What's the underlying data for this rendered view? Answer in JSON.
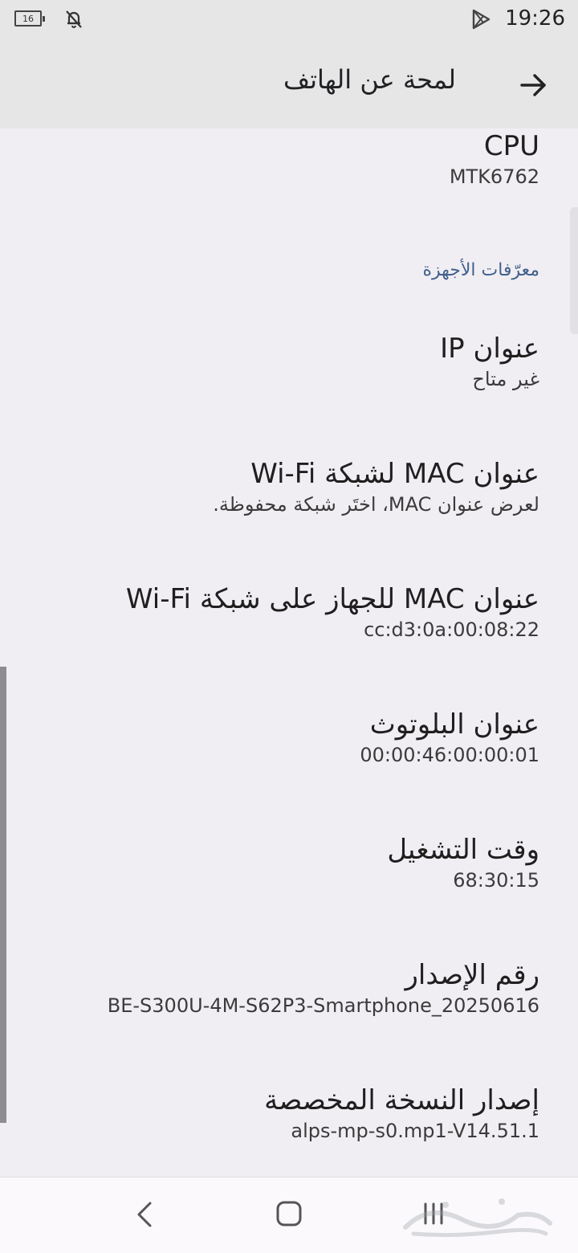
{
  "status_bar": {
    "battery_level": "16",
    "time": "19:26",
    "icons": [
      "battery-icon",
      "bell-off-icon",
      "play-store-icon"
    ]
  },
  "header": {
    "title": "لمحة عن الهاتف",
    "back_icon": "back-arrow-icon"
  },
  "content": {
    "cpu": {
      "title": "CPU",
      "summary": "MTK6762"
    },
    "category_label": "معرّفات الأجهزة",
    "items": [
      {
        "title": "عنوان IP",
        "summary": "غير متاح"
      },
      {
        "title": "عنوان MAC لشبكة Wi-Fi",
        "summary": "لعرض عنوان MAC، اختَر شبكة محفوظة."
      },
      {
        "title": "عنوان MAC للجهاز على شبكة Wi-Fi",
        "summary": "00:08:22:cc:d3:0a"
      },
      {
        "title": "عنوان البلوتوث",
        "summary": "00:00:46:00:00:01"
      },
      {
        "title": "وقت التشغيل",
        "summary": "68:30:15"
      },
      {
        "title": "رقم الإصدار",
        "summary": "BE-S300U-4M-S62P3-Smartphone_20250616"
      },
      {
        "title": "إصدار النسخة المخصصة",
        "summary": "alps-mp-s0.mp1-V14.51.1"
      }
    ]
  },
  "nav_bar": {
    "icons": [
      "nav-back-icon",
      "nav-home-icon",
      "nav-recents-icon"
    ]
  },
  "colors": {
    "background": "#f1eef3",
    "header": "#e6e6e6",
    "category": "#41608c"
  }
}
